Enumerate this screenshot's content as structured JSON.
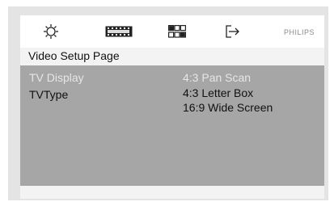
{
  "header": {
    "icons": [
      "general-setup-icon",
      "audio-setup-icon",
      "video-setup-icon",
      "exit-icon"
    ],
    "brand": "PHILIPS"
  },
  "page": {
    "title": "Video Setup Page"
  },
  "menu": {
    "items": [
      {
        "label": "TV Display",
        "highlighted": true
      },
      {
        "label": "TVType",
        "highlighted": false
      }
    ]
  },
  "options": {
    "items": [
      {
        "label": "4:3 Pan Scan",
        "highlighted": true
      },
      {
        "label": "4:3 Letter Box",
        "highlighted": false
      },
      {
        "label": "16:9 Wide Screen",
        "highlighted": false
      }
    ]
  },
  "colors": {
    "frame": "#e4e4e4",
    "content_bg": "#a6a6a6",
    "highlight_text": "#e6e6e6",
    "normal_text": "#111111"
  }
}
